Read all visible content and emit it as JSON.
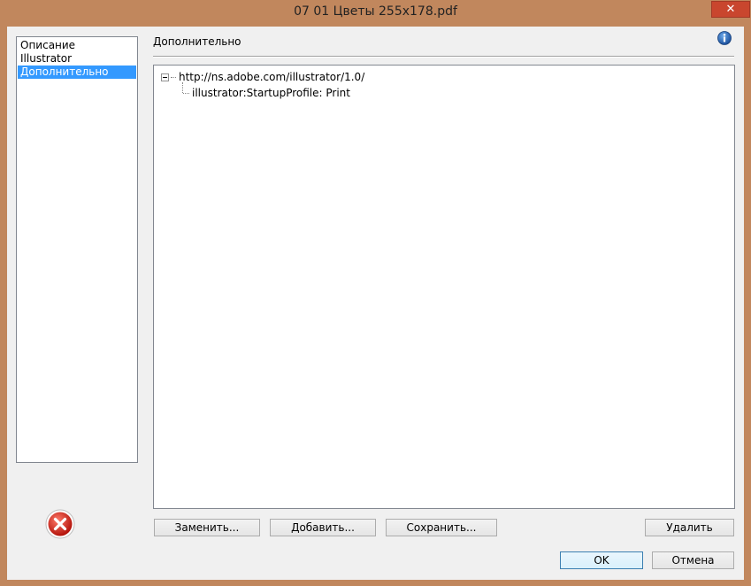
{
  "window": {
    "title": "07 01 Цветы 255x178.pdf",
    "close_label": "✕"
  },
  "sidebar": {
    "items": [
      {
        "label": "Описание",
        "selected": false
      },
      {
        "label": "Illustrator",
        "selected": false
      },
      {
        "label": "Дополнительно",
        "selected": true
      }
    ]
  },
  "section": {
    "title": "Дополнительно"
  },
  "tree": {
    "root": "http://ns.adobe.com/illustrator/1.0/",
    "child": "illustrator:StartupProfile: Print"
  },
  "buttons": {
    "replace": "Заменить...",
    "add": "Добавить...",
    "save": "Сохранить...",
    "delete": "Удалить",
    "ok": "OK",
    "cancel": "Отмена"
  },
  "colors": {
    "selection": "#3399ff",
    "titlebar": "#c1875d",
    "close": "#c9462e"
  }
}
